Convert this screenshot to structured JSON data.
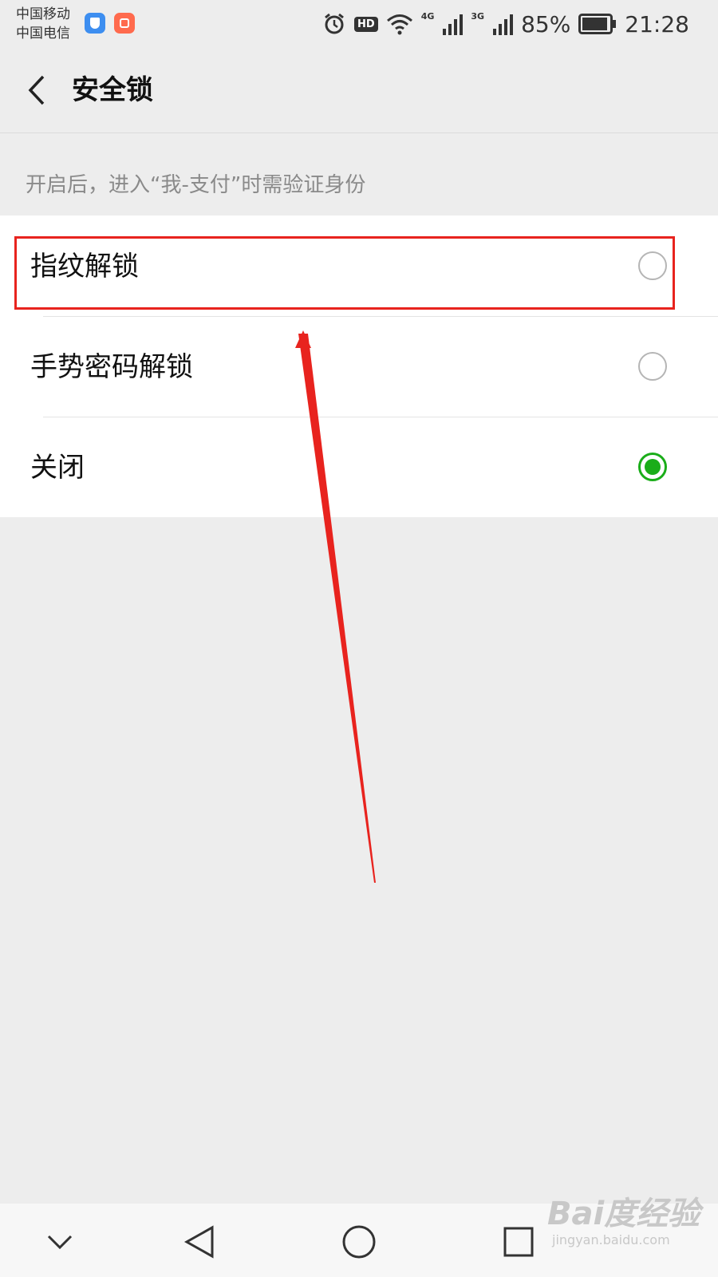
{
  "status_bar": {
    "carrier_1": "中国移动",
    "carrier_2": "中国电信",
    "hd_label": "HD",
    "network_1": "4G",
    "network_2": "3G",
    "battery_percent": "85%",
    "time": "21:28",
    "icons": [
      "shield-app-icon",
      "red-app-icon",
      "alarm-icon",
      "wifi-icon",
      "signal-icon",
      "battery-icon"
    ]
  },
  "header": {
    "title": "安全锁"
  },
  "hint": "开启后，进入“我-支付”时需验证身份",
  "options": [
    {
      "label": "指纹解锁",
      "selected": false
    },
    {
      "label": "手势密码解锁",
      "selected": false
    },
    {
      "label": "关闭",
      "selected": true
    }
  ],
  "annotation_color": "#e8231e",
  "accent_color": "#1aad19",
  "bottom_nav": {
    "icons": [
      "chevron-down-icon",
      "back-triangle-icon",
      "home-circle-icon",
      "recents-square-icon"
    ]
  },
  "watermark": {
    "logo": "Bai度经验",
    "url": "jingyan.baidu.com"
  }
}
